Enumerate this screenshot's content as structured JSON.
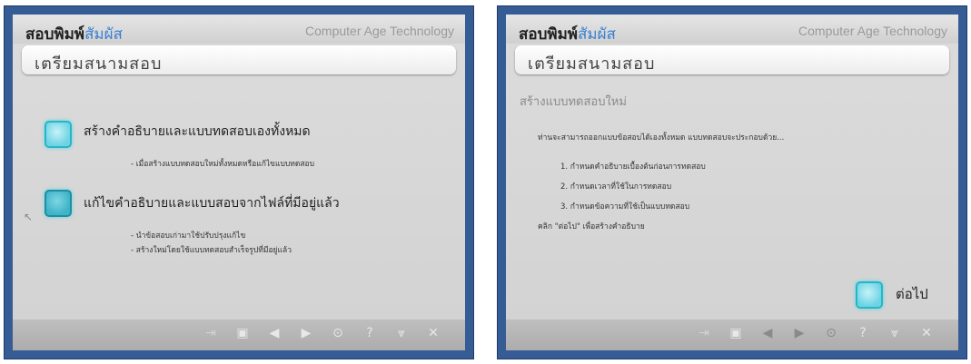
{
  "screens": [
    {
      "brand_main": "สอบพิมพ์",
      "brand_accent": "สัมผัส",
      "company": "Computer Age Technology",
      "page_title": "เตรียมสนามสอบ",
      "options": [
        {
          "label": "สร้างคำอธิบายและแบบทดสอบเองทั้งหมด",
          "bullets": [
            "- เมื่อสร้างแบบทดสอบใหม่ทั้งหมดหรือแก้ไขแบบทดสอบ"
          ]
        },
        {
          "label": "แก้ไขคำอธิบายและแบบสอบจากไฟล์ที่มีอยู่แล้ว",
          "bullets": [
            "- นำข้อสอบเก่ามาใช้ปรับปรุงแก้ไข",
            "- สร้างใหม่โดยใช้แบบทดสอบสำเร็จรูปที่มีอยู่แล้ว"
          ]
        }
      ]
    },
    {
      "brand_main": "สอบพิมพ์",
      "brand_accent": "สัมผัส",
      "company": "Computer Age Technology",
      "page_title": "เตรียมสนามสอบ",
      "section_title": "สร้างแบบทดสอบใหม่",
      "intro": "ท่านจะสามารถออกแบบข้อสอบได้เองทั้งหมด แบบทดสอบจะประกอบด้วย...",
      "steps": [
        "1. กำหนดคำอธิบายเบื้องต้นก่อนการทดสอบ",
        "2. กำหนดเวลาที่ใช้ในการทดสอบ",
        "3. กำหนดข้อความที่ใช้เป็นแบบทดสอบ"
      ],
      "hint": "คลิก \"ต่อไป\" เพื่อสร้างคำอธิบาย",
      "next_label": "ต่อไป"
    }
  ],
  "toolbar": {
    "icons": [
      "exit-icon",
      "save-icon",
      "back-icon",
      "forward-icon",
      "settings-icon",
      "help-icon",
      "minimize-icon",
      "close-icon"
    ],
    "glyphs": [
      "⇥",
      "▣",
      "◀",
      "▶",
      "⊙",
      "?",
      "⩔",
      "✕"
    ]
  },
  "colors": {
    "frame": "#365c96",
    "panel": "#d6d6d6",
    "accent": "#3a7fd1",
    "button": "#6fd3e4"
  }
}
